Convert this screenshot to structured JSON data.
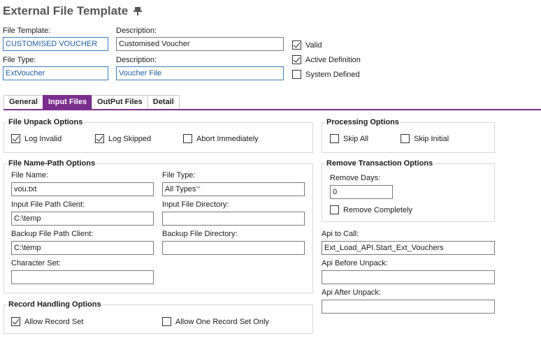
{
  "header": {
    "title": "External File Template"
  },
  "form": {
    "file_template_label": "File Template:",
    "file_template_value": "CUSTOMISED VOUCHER",
    "description_label": "Description:",
    "description_value": "Customised Voucher",
    "file_type_label": "File Type:",
    "file_type_value": "ExtVoucher",
    "description2_label": "Description:",
    "description2_value": "Voucher File",
    "valid_label": "Valid",
    "active_label": "Active Definition",
    "system_label": "System Defined"
  },
  "tabs": [
    {
      "label": "General"
    },
    {
      "label": "Input Files"
    },
    {
      "label": "OutPut Files"
    },
    {
      "label": "Detail"
    }
  ],
  "unpack": {
    "title": "File Unpack Options",
    "log_invalid": "Log Invalid",
    "log_skipped": "Log Skipped",
    "abort": "Abort Immediately"
  },
  "processing": {
    "title": "Processing Options",
    "skip_all": "Skip All",
    "skip_initial": "Skip Initial"
  },
  "namepath": {
    "title": "File Name-Path Options",
    "file_name_label": "File Name:",
    "file_name_value": "vou.txt",
    "file_type_label": "File Type:",
    "file_type_value": "All Types",
    "input_client_label": "Input File Path Client:",
    "input_client_value": "C:\\temp",
    "input_dir_label": "Input File Directory:",
    "input_dir_value": "",
    "backup_client_label": "Backup File Path Client:",
    "backup_client_value": "C:\\temp",
    "backup_dir_label": "Backup File Directory:",
    "backup_dir_value": "",
    "charset_label": "Character Set:",
    "charset_value": ""
  },
  "remove": {
    "title": "Remove Transaction Options",
    "days_label": "Remove Days:",
    "days_value": "0",
    "completely": "Remove Completely"
  },
  "api": {
    "call_label": "Api to Call:",
    "call_value": "Ext_Load_API.Start_Ext_Vouchers",
    "before_label": "Api Before Unpack:",
    "before_value": "",
    "after_label": "Api After Unpack:",
    "after_value": ""
  },
  "record": {
    "title": "Record Handling Options",
    "allow_set": "Allow Record Set",
    "allow_one": "Allow One Record Set Only"
  }
}
